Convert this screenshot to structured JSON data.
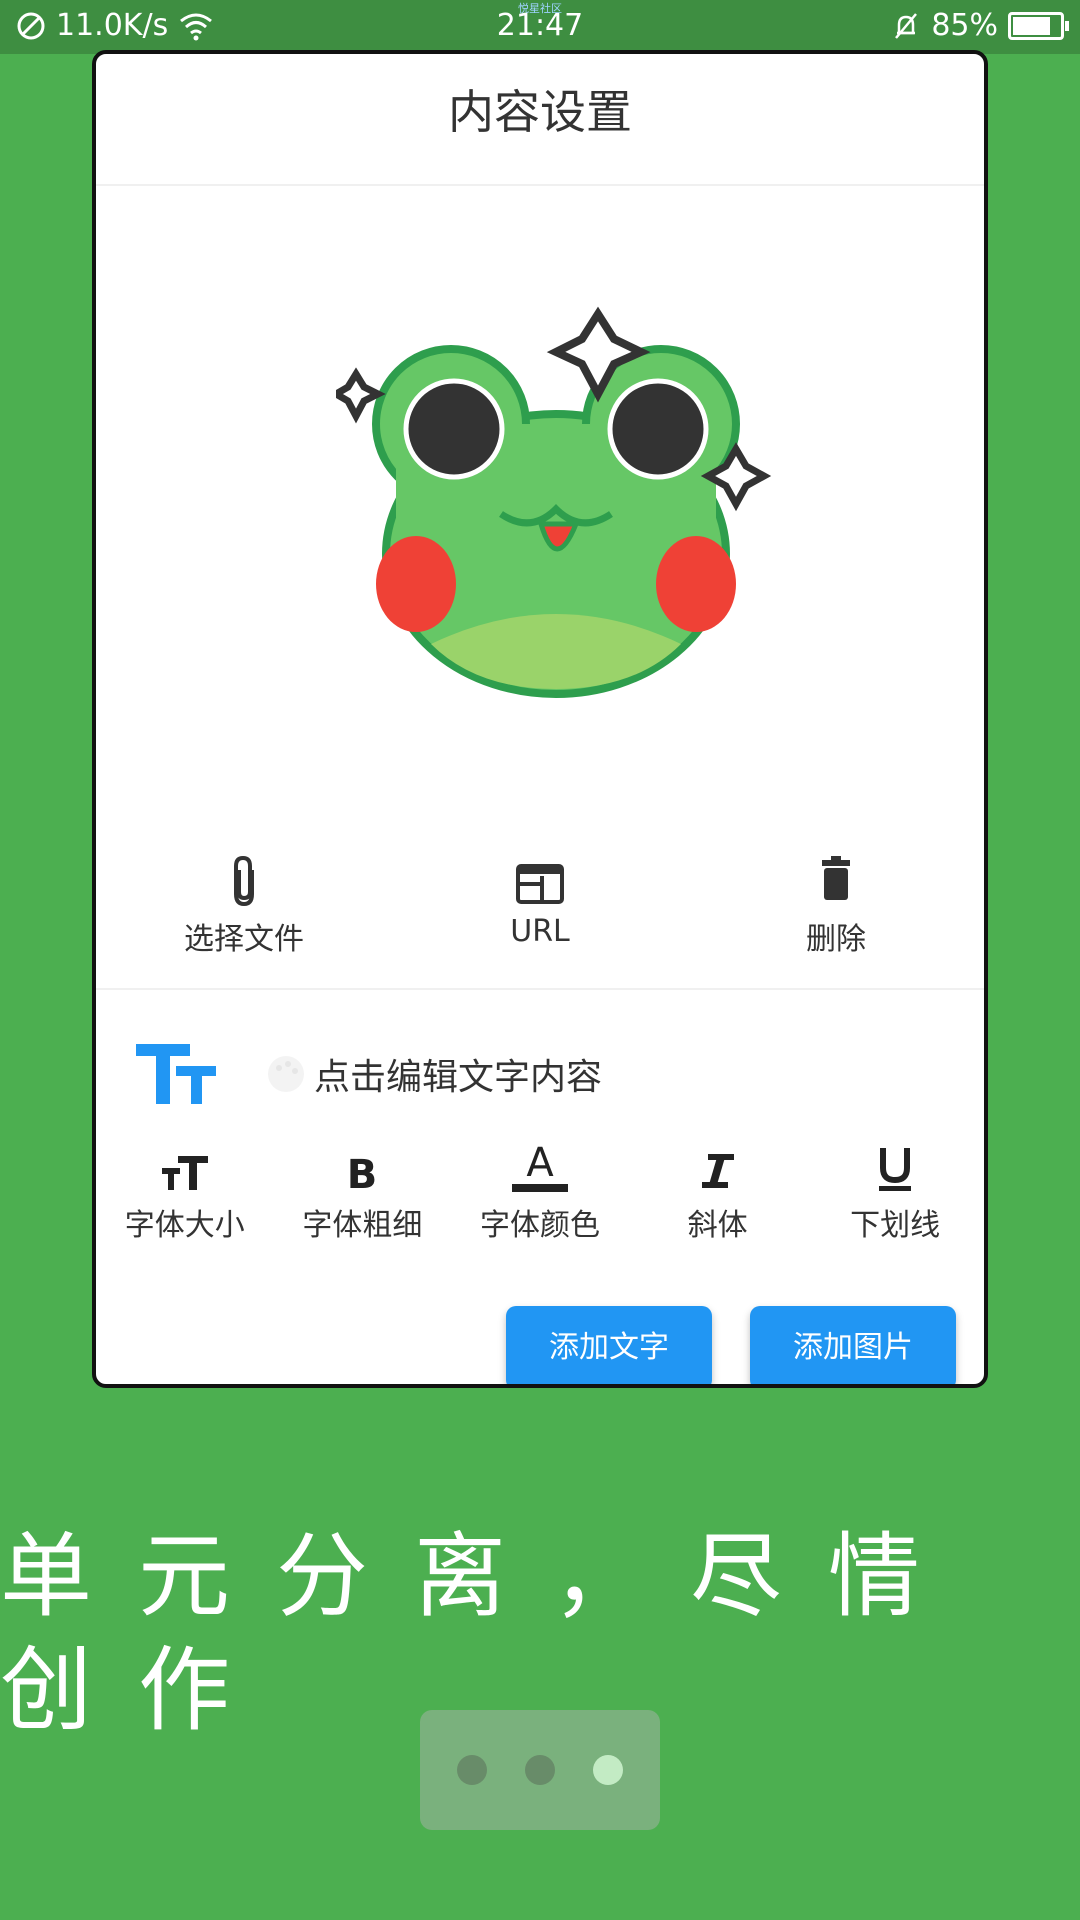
{
  "status_bar": {
    "speed": "11.0K/s",
    "time": "21:47",
    "tiny_label": "悦星社区",
    "battery": "85%",
    "battery_level": 0.85
  },
  "card": {
    "title": "内容设置",
    "file_actions": [
      {
        "label": "选择文件",
        "icon": "paperclip-icon"
      },
      {
        "label": "URL",
        "icon": "web-icon"
      },
      {
        "label": "删除",
        "icon": "trash-icon"
      }
    ],
    "text_placeholder": "点击编辑文字内容",
    "format_tools": [
      {
        "label": "字体大小",
        "icon": "font-size-icon"
      },
      {
        "label": "字体粗细",
        "icon": "bold-icon"
      },
      {
        "label": "字体颜色",
        "icon": "font-color-icon"
      },
      {
        "label": "斜体",
        "icon": "italic-icon"
      },
      {
        "label": "下划线",
        "icon": "underline-icon"
      }
    ],
    "buttons": {
      "add_text": "添加文字",
      "add_image": "添加图片"
    }
  },
  "slogan": "单元分离，尽情创作",
  "pager": {
    "count": 3,
    "active_index": 2
  },
  "colors": {
    "background": "#4caf50",
    "accent": "#2196f3",
    "frog_green": "#66c766",
    "frog_cheek": "#ef4136"
  }
}
